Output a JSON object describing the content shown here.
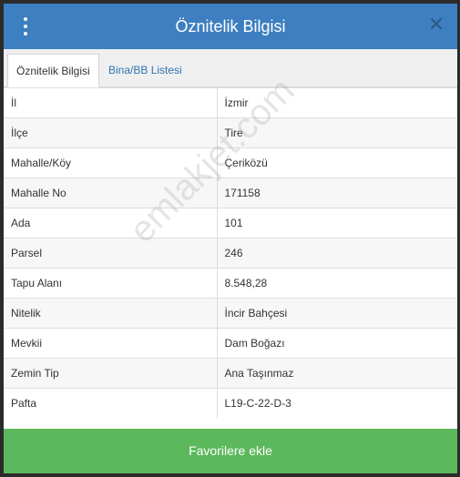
{
  "header": {
    "title": "Öznitelik Bilgisi"
  },
  "tabs": [
    {
      "label": "Öznitelik Bilgisi"
    },
    {
      "label": "Bina/BB Listesi"
    }
  ],
  "rows": [
    {
      "label": "İl",
      "value": "İzmir"
    },
    {
      "label": "İlçe",
      "value": "Tire"
    },
    {
      "label": "Mahalle/Köy",
      "value": "Çeriközü"
    },
    {
      "label": "Mahalle No",
      "value": "171158"
    },
    {
      "label": "Ada",
      "value": "101"
    },
    {
      "label": "Parsel",
      "value": "246"
    },
    {
      "label": "Tapu Alanı",
      "value": "8.548,28"
    },
    {
      "label": "Nitelik",
      "value": "İncir Bahçesi"
    },
    {
      "label": "Mevkii",
      "value": "Dam Boğazı"
    },
    {
      "label": "Zemin Tip",
      "value": "Ana Taşınmaz"
    },
    {
      "label": "Pafta",
      "value": "L19-C-22-D-3"
    }
  ],
  "watermark": "emlakjet.com",
  "footer": {
    "button_label": "Favorilere ekle"
  },
  "colors": {
    "header": "#3d7fc0",
    "footer": "#5cb85c",
    "tab_link": "#2f73b3"
  }
}
